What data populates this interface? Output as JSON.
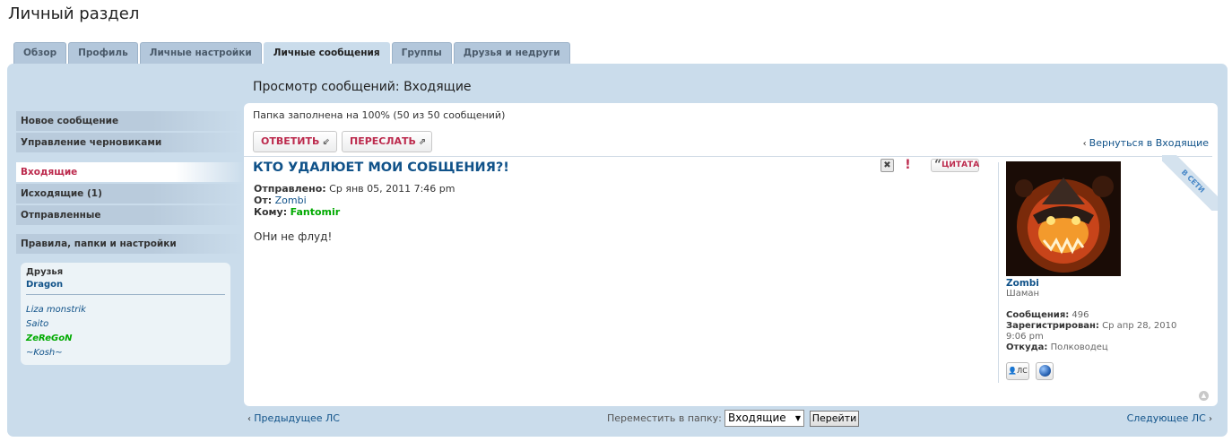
{
  "page_title": "Личный раздел",
  "tabs": [
    {
      "label": "Обзор"
    },
    {
      "label": "Профиль"
    },
    {
      "label": "Личные настройки"
    },
    {
      "label": "Личные сообщения",
      "active": true
    },
    {
      "label": "Группы"
    },
    {
      "label": "Друзья и недруги"
    }
  ],
  "sidebar": {
    "group1": [
      "Новое сообщение",
      "Управление черновиками"
    ],
    "group2": [
      "Входящие",
      "Исходящие (1)",
      "Отправленные"
    ],
    "group3": [
      "Правила, папки и настройки"
    ],
    "active_item": "Входящие"
  },
  "friends": {
    "header": "Друзья",
    "online": [
      "Dragon"
    ],
    "offline": [
      "Liza monstrik",
      "Saito",
      "ZeReGoN",
      "~Kosh~"
    ]
  },
  "view_title": "Просмотр сообщений: Входящие",
  "folder_status": "Папка заполнена на 100% (50 из 50 сообщений)",
  "actions": {
    "reply": "ОТВЕТИТЬ",
    "forward": "ПЕРЕСЛАТЬ",
    "back": "Вернуться в Входящие"
  },
  "message": {
    "subject": "КТО УДАЛЮЕТ МОИ СОБЩЕНИЯ?!",
    "sent_label": "Отправлено:",
    "sent_value": "Ср янв 05, 2011 7:46 pm",
    "from_label": "От:",
    "from_value": "Zombi",
    "to_label": "Кому:",
    "to_value": "Fantomir",
    "body": "ОНи не флуд!",
    "quote_label": "ЦИТАТА",
    "delete_glyph": "✖",
    "warn_glyph": "!"
  },
  "author": {
    "online_badge": "В СЕТИ",
    "name": "Zombi",
    "rank": "Шаман",
    "posts_label": "Сообщения:",
    "posts_value": "496",
    "registered_label": "Зарегистрирован:",
    "registered_value": "Ср апр 28, 2010 9:06 pm",
    "from_label": "Откуда:",
    "from_value": "Полководец",
    "pm_label": "ЛС"
  },
  "footer": {
    "prev": "Предыдущее ЛС",
    "next": "Следующее ЛС",
    "move_label": "Переместить в папку:",
    "folder_selected": "Входящие",
    "go": "Перейти"
  },
  "colors": {
    "panel_bg": "#cadceb",
    "link": "#105289",
    "accent": "#bc2a4d",
    "online_green": "#00aa00"
  }
}
